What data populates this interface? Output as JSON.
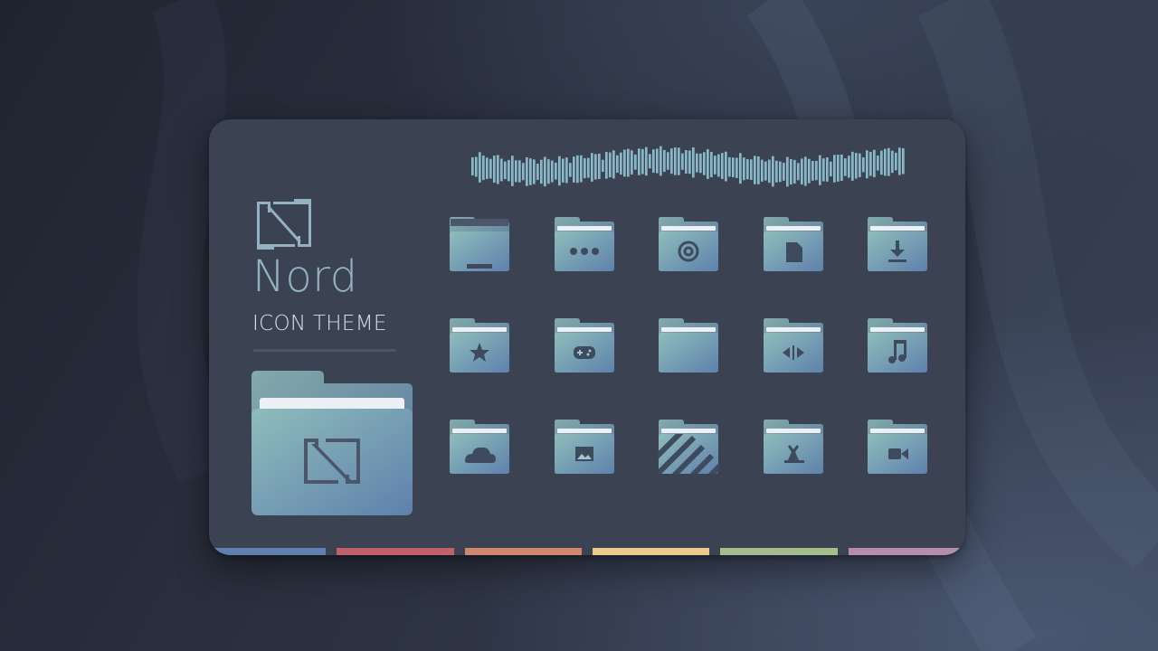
{
  "brand": {
    "title": "Nord",
    "subtitle": "ICON THEME"
  },
  "colors": {
    "background": "#2b3140",
    "card": "#3b4252",
    "accent": "#93b3c2",
    "folder_gradient_start": "#8fbcbb",
    "folder_gradient_end": "#5e81ac",
    "folder_tab_light": "#eceff4",
    "glyph": "#3e4a5e"
  },
  "folders": [
    {
      "icon": "desktop-folder-icon"
    },
    {
      "icon": "more-folder-icon"
    },
    {
      "icon": "at-folder-icon"
    },
    {
      "icon": "documents-folder-icon"
    },
    {
      "icon": "downloads-folder-icon"
    },
    {
      "icon": "favorites-folder-icon"
    },
    {
      "icon": "games-folder-icon"
    },
    {
      "icon": "generic-folder-icon"
    },
    {
      "icon": "development-folder-icon"
    },
    {
      "icon": "music-folder-icon"
    },
    {
      "icon": "cloud-folder-icon"
    },
    {
      "icon": "pictures-folder-icon"
    },
    {
      "icon": "templates-folder-icon"
    },
    {
      "icon": "recreation-folder-icon"
    },
    {
      "icon": "videos-folder-icon"
    }
  ],
  "palette_stripes": [
    "#5e81ac",
    "#bf616a",
    "#d08770",
    "#ebcb8b",
    "#a3be8c",
    "#b48ead"
  ]
}
